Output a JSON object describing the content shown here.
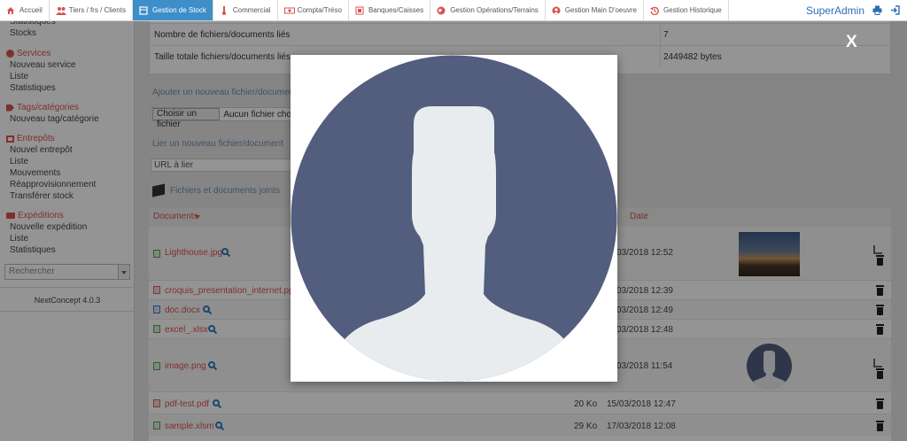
{
  "topbar": {
    "tabs": [
      {
        "label": "Accueil",
        "icon": "home-icon",
        "color": "#d9534f"
      },
      {
        "label": "Tiers / frs / Clients",
        "icon": "users-icon",
        "color": "#d9534f"
      },
      {
        "label": "Gestion de Stock",
        "icon": "stock-icon",
        "color": "#ffffff",
        "active": true
      },
      {
        "label": "Commercial",
        "icon": "thermometer-icon",
        "color": "#d9534f"
      },
      {
        "label": "Compta/Tréso",
        "icon": "money-icon",
        "color": "#d9534f"
      },
      {
        "label": "Banques/Caisses",
        "icon": "bank-icon",
        "color": "#d9534f"
      },
      {
        "label": "Gestion Opérations/Terrains",
        "icon": "globe-icon",
        "color": "#d9534f"
      },
      {
        "label": "Gestion Main D'oeuvre",
        "icon": "worker-icon",
        "color": "#d9534f"
      },
      {
        "label": "Gestion Historique",
        "icon": "history-icon",
        "color": "#d9534f"
      }
    ],
    "user": "SuperAdmin",
    "print_icon": "print-icon",
    "logout_icon": "logout-icon"
  },
  "sidebar": {
    "stock_items": [
      "Statistiques",
      "Stocks"
    ],
    "services": {
      "title": "Services",
      "items": [
        "Nouveau service",
        "Liste",
        "Statistiques"
      ]
    },
    "tags": {
      "title": "Tags/catégories",
      "items": [
        "Nouveau tag/catégorie"
      ]
    },
    "entrepots": {
      "title": "Entrepôts",
      "items": [
        "Nouvel entrepôt",
        "Liste",
        "Mouvements",
        "Réapprovisionnement",
        "Transférer stock"
      ]
    },
    "expeditions": {
      "title": "Expéditions",
      "items": [
        "Nouvelle expédition",
        "Liste",
        "Statistiques"
      ]
    },
    "search_placeholder": "Rechercher",
    "version": "NextConcept 4.0.3"
  },
  "info": {
    "rows": [
      {
        "label": "Nombre de fichiers/documents liés",
        "value": "7"
      },
      {
        "label": "Taille totale fichiers/documents liés",
        "value": "2449482 bytes"
      }
    ]
  },
  "upload": {
    "add_title": "Ajouter un nouveau fichier/document",
    "choose_button": "Choisir un fichier",
    "no_file": "Aucun fichier choisi",
    "link_title": "Lier un nouveau fichier/document",
    "url_placeholder": "URL à lier"
  },
  "files": {
    "title": "Fichiers et documents joints",
    "columns": {
      "documents": "Documents",
      "date": "Date"
    },
    "rows": [
      {
        "name": "Lighthouse.jpg",
        "size": "",
        "date": "03/2018 12:52"
      },
      {
        "name": "croquis_presentation_internet.ppt",
        "size": "",
        "date": "03/2018 12:39"
      },
      {
        "name": "doc.docx",
        "size": "",
        "date": "03/2018 12:49"
      },
      {
        "name": "excel_.xlsx",
        "size": "",
        "date": "03/2018 12:48"
      },
      {
        "name": "image.png",
        "size": "",
        "date": "03/2018 11:54"
      },
      {
        "name": "pdf-test.pdf",
        "size": "20 Ko",
        "date": "15/03/2018 12:47"
      },
      {
        "name": "sample.xlsm",
        "size": "29 Ko",
        "date": "17/03/2018 12:08"
      }
    ]
  },
  "lightbox": {
    "close_label": "X",
    "image": "avatar-placeholder",
    "avatar_bg": "#535d7e",
    "silhouette": "#e8ecee"
  }
}
